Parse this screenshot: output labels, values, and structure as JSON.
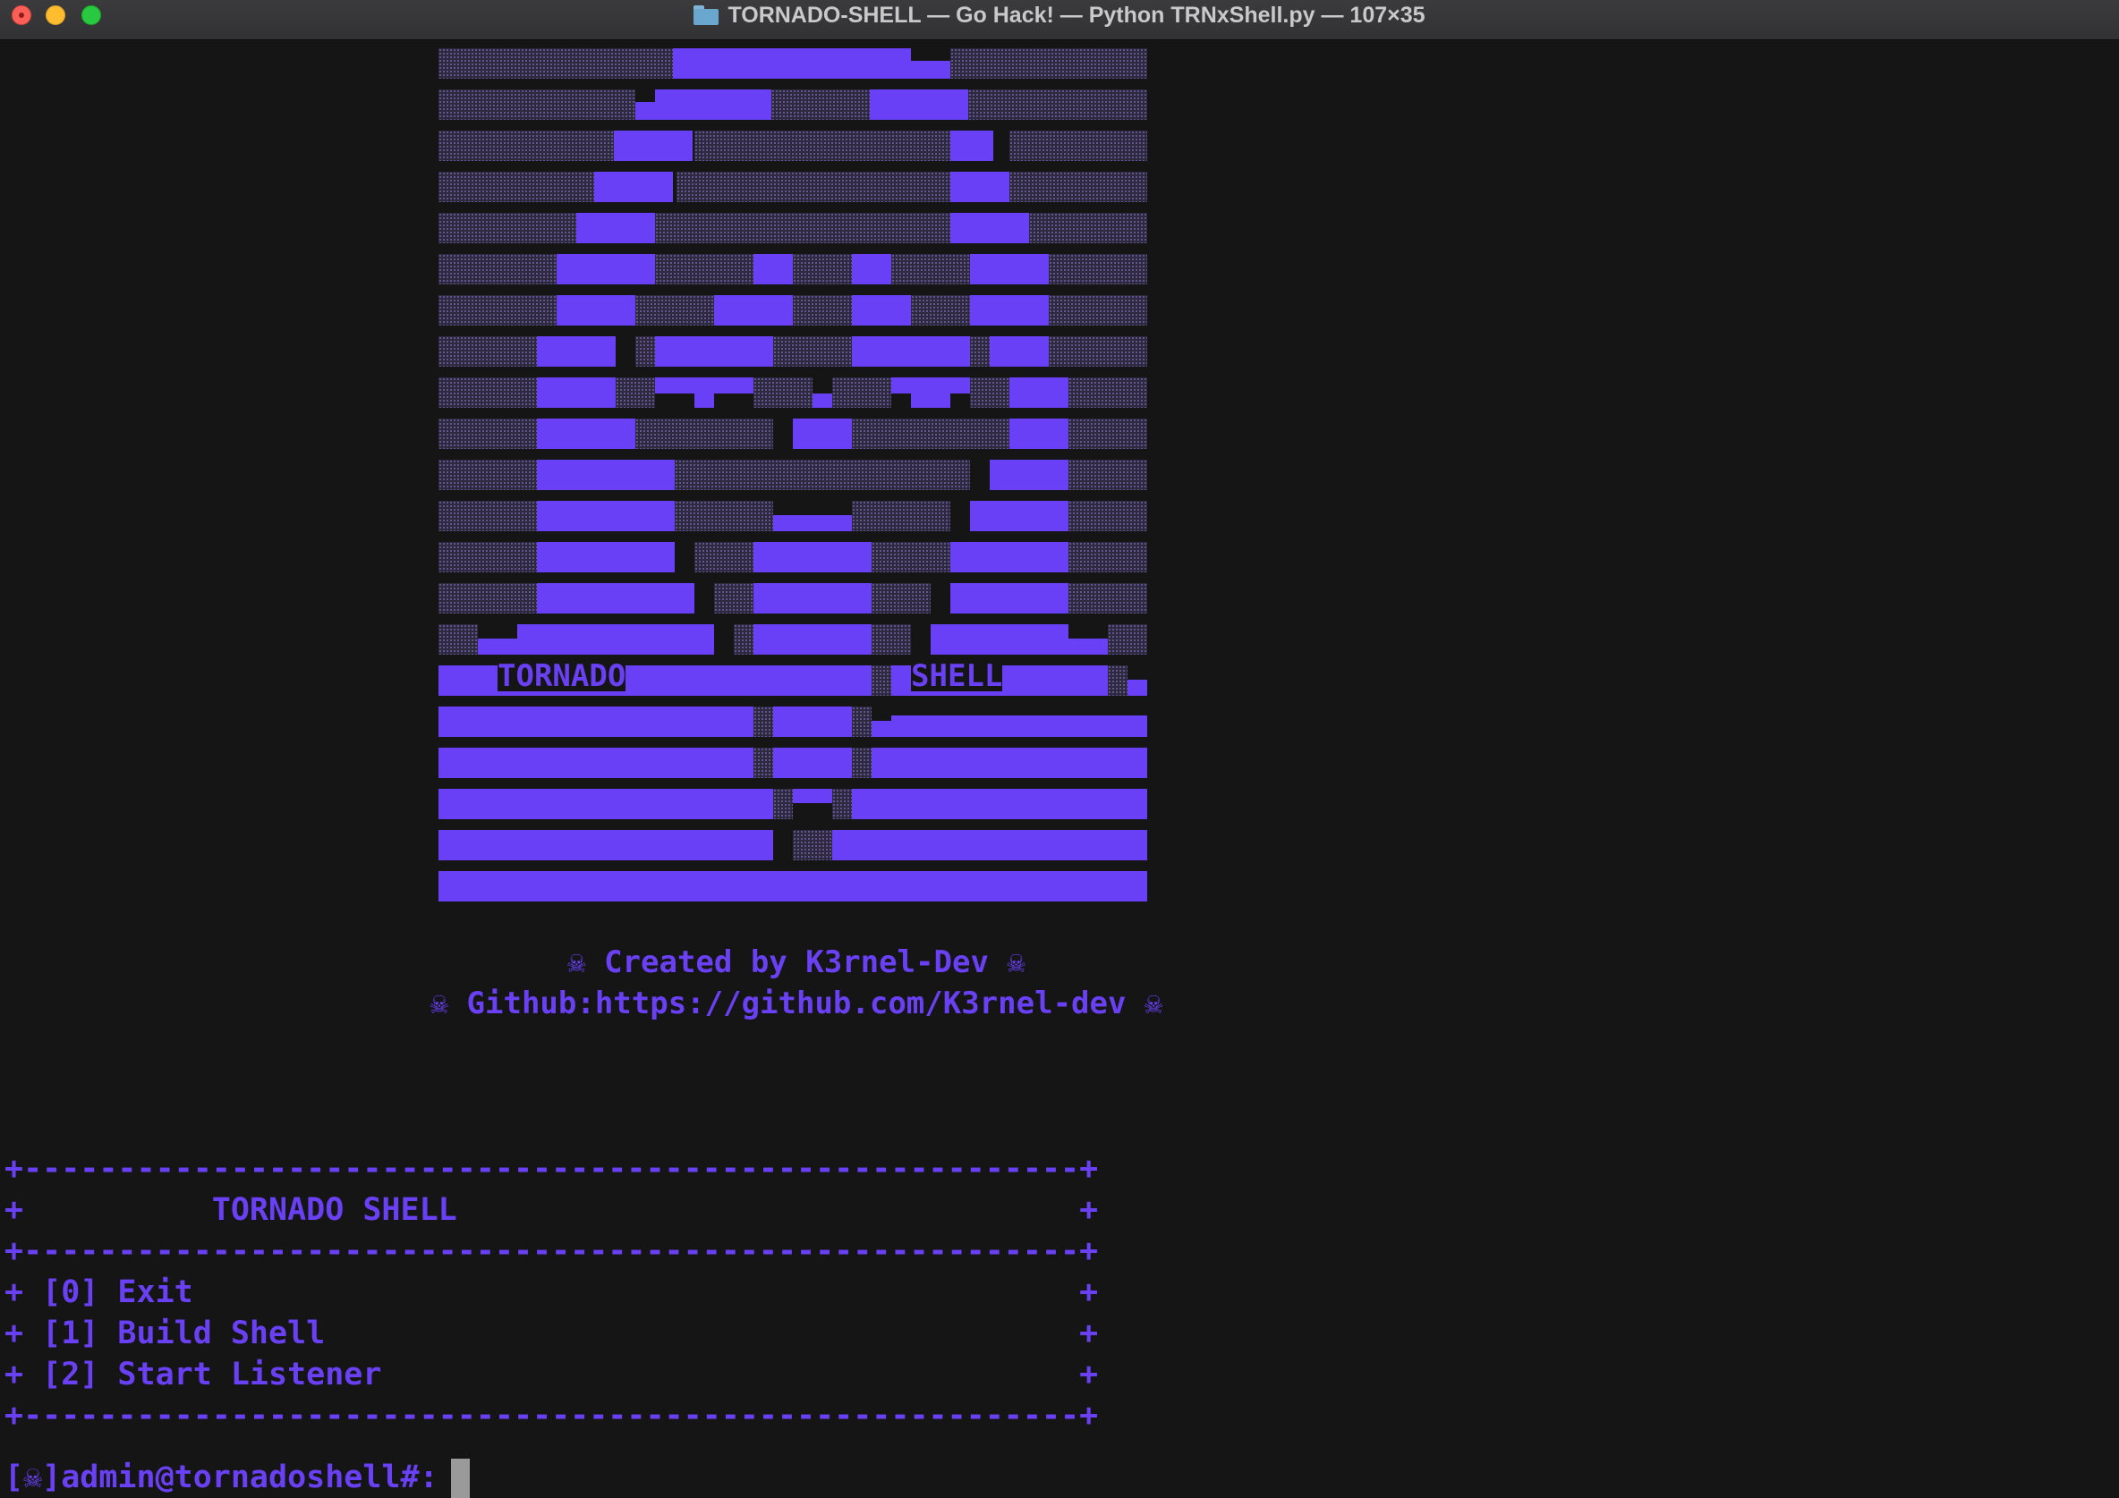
{
  "window": {
    "title": "TORNADO-SHELL — Go Hack! — Python TRNxShell.py — 107×35",
    "folder_icon": "folder-icon"
  },
  "art": {
    "label_left": "TORNADO",
    "label_right": "SHELL"
  },
  "credits": {
    "line1": "☠ Created by K3rnel-Dev ☠",
    "line2": "☠ Github:https://github.com/K3rnel-dev ☠"
  },
  "menu": {
    "border": "+--------------------------------------------------------+",
    "title_row": "+          TORNADO SHELL                                 +",
    "items": [
      "+ [0] Exit                                               +",
      "+ [1] Build Shell                                        +",
      "+ [2] Start Listener                                     +"
    ]
  },
  "prompt": {
    "text": "[☠]admin@tornadoshell#:"
  },
  "colors": {
    "accent": "#6a40f6",
    "background": "#151515",
    "dither": "#2d2a3d"
  }
}
